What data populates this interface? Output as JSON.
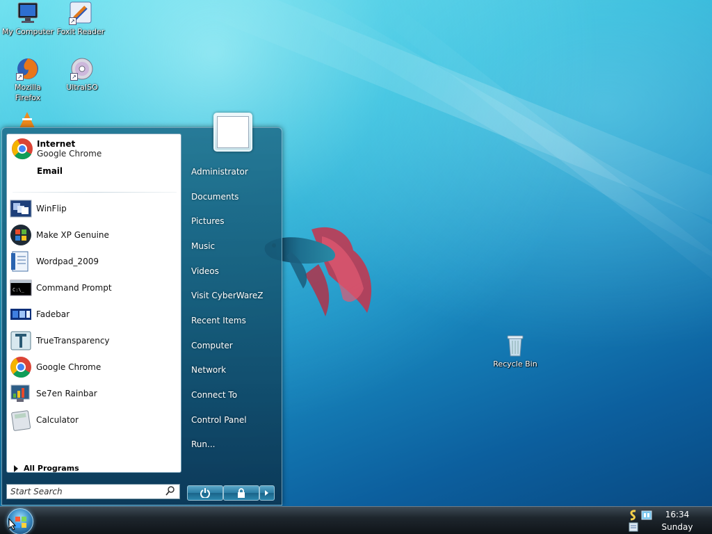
{
  "desktop": {
    "icons": [
      {
        "label": "My Computer",
        "icon": "monitor-icon"
      },
      {
        "label": "Foxit Reader",
        "icon": "foxit-reader-icon"
      },
      {
        "label": "Mozilla Firefox",
        "icon": "firefox-icon"
      },
      {
        "label": "UltraISO",
        "icon": "disc-icon"
      },
      {
        "label": "Recycle Bin",
        "icon": "recycle-bin-icon"
      }
    ]
  },
  "start_menu": {
    "pinned": {
      "internet_title": "Internet",
      "internet_sub": "Google Chrome",
      "email_title": "Email"
    },
    "programs": [
      {
        "label": "WinFlip",
        "icon": "winflip-icon"
      },
      {
        "label": "Make XP Genuine",
        "icon": "windows-logo-icon"
      },
      {
        "label": "Wordpad_2009",
        "icon": "wordpad-icon"
      },
      {
        "label": "Command Prompt",
        "icon": "command-prompt-icon"
      },
      {
        "label": "Fadebar",
        "icon": "fadebar-icon"
      },
      {
        "label": "TrueTransparency",
        "icon": "truetransparency-icon"
      },
      {
        "label": "Google Chrome",
        "icon": "chrome-icon"
      },
      {
        "label": "Se7en Rainbar",
        "icon": "rainbar-icon"
      },
      {
        "label": "Calculator",
        "icon": "calculator-icon"
      }
    ],
    "all_programs": "All Programs",
    "search_placeholder": "Start Search",
    "right_items": [
      "Administrator",
      "Documents",
      "Pictures",
      "Music",
      "Videos",
      "Visit CyberWareZ",
      "Recent Items",
      "Computer",
      "Network",
      "Connect To",
      "Control Panel",
      "Run..."
    ]
  },
  "taskbar": {
    "time": "16:34",
    "day": "Sunday"
  }
}
